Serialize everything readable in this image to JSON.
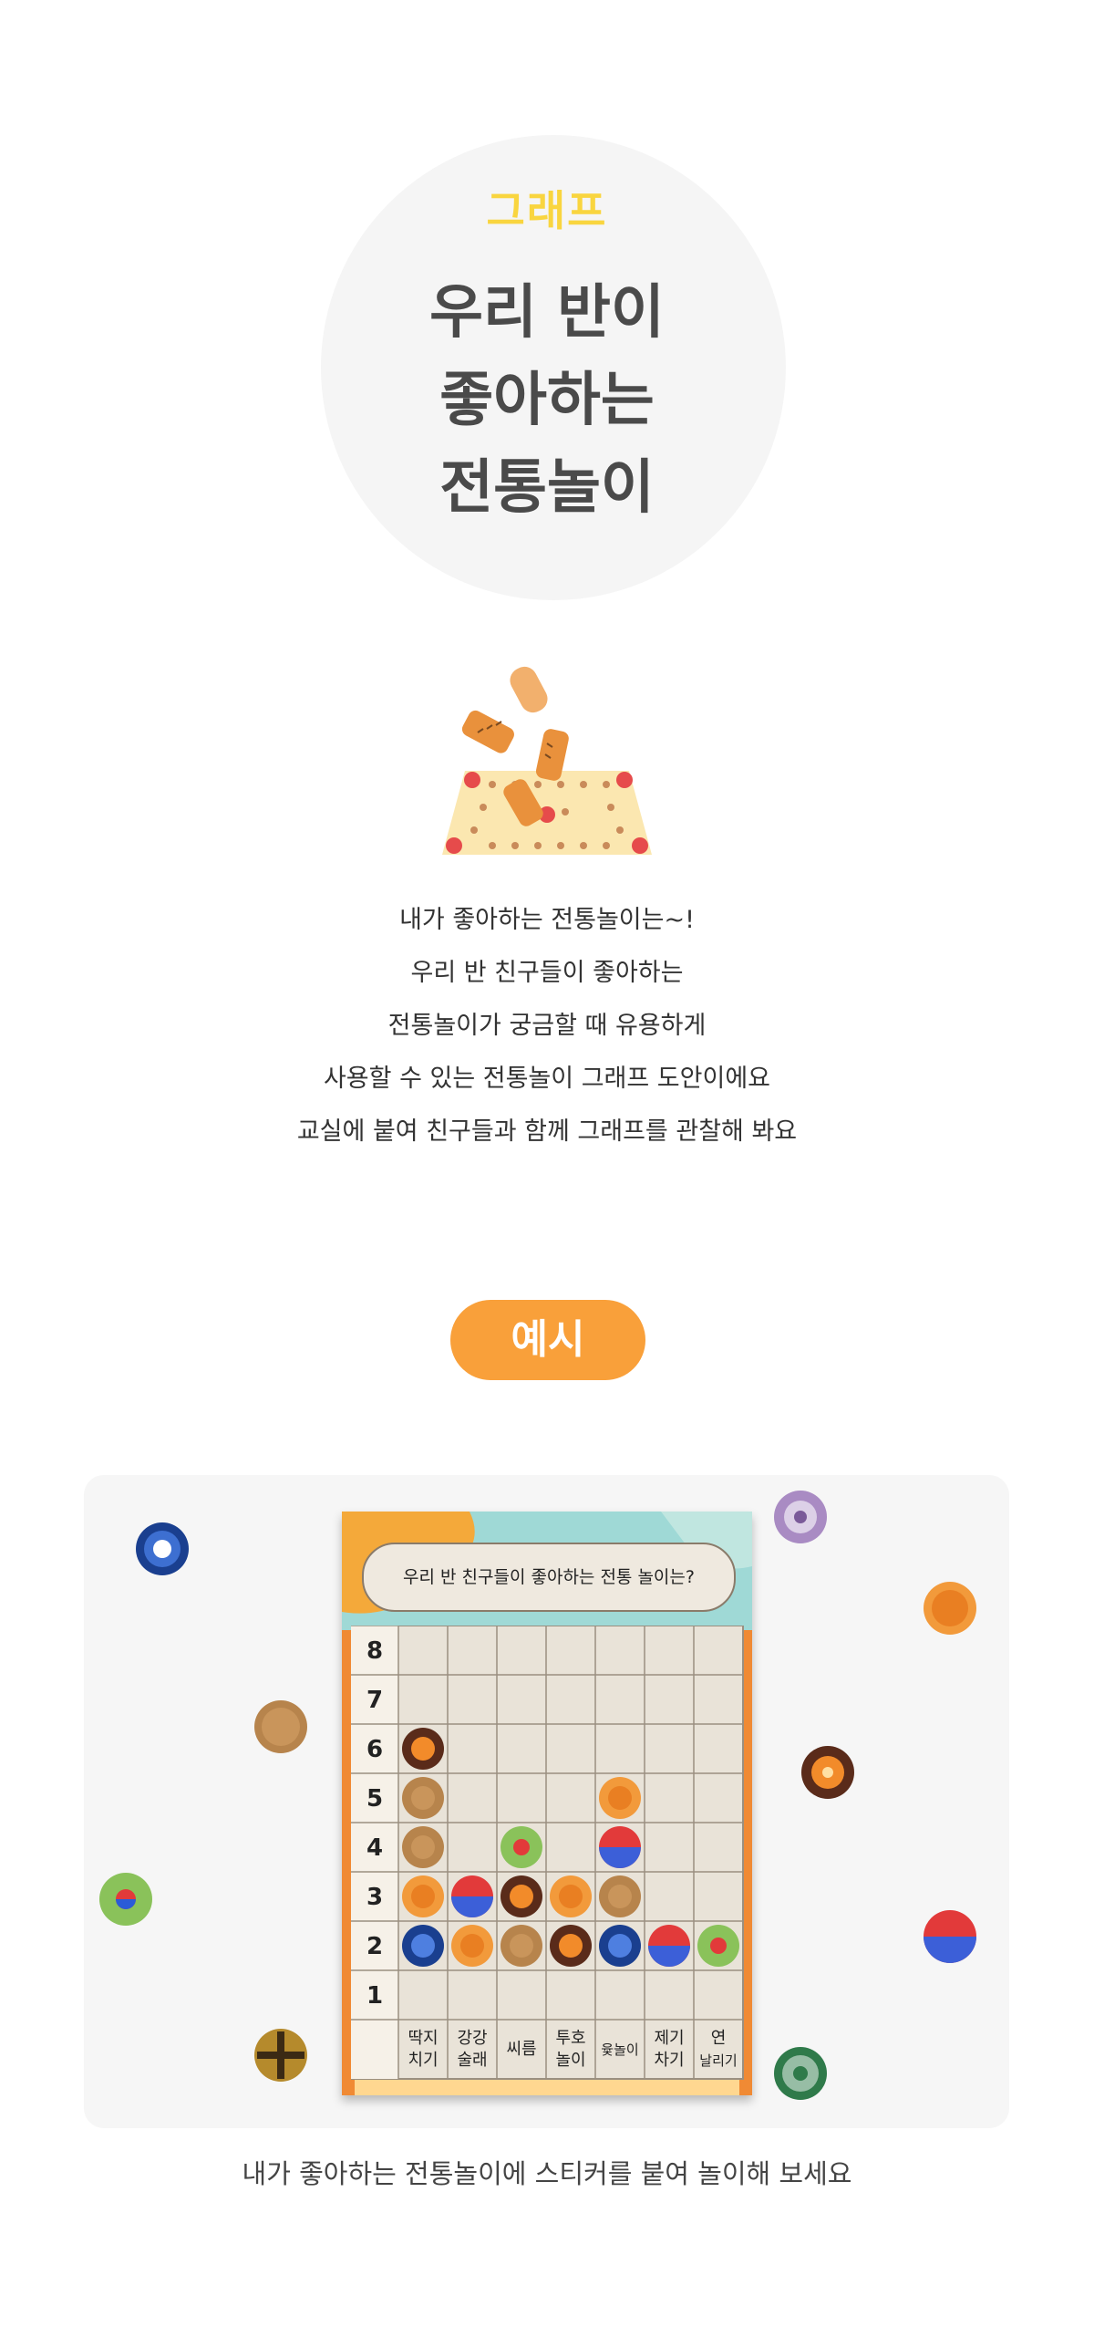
{
  "hero": {
    "tag": "그래프",
    "title_lines": [
      "우리 반이",
      "좋아하는",
      "전통놀이"
    ]
  },
  "description": {
    "lines": [
      "내가 좋아하는 전통놀이는~!",
      "우리 반 친구들이 좋아하는",
      "전통놀이가 궁금할 때 유용하게",
      "사용할 수 있는 전통놀이 그래프 도안이에요",
      "교실에 붙여 친구들과 함께 그래프를 관찰해 봐요"
    ]
  },
  "example": {
    "label": "예시"
  },
  "board": {
    "question": "우리 반 친구들이 좋아하는 전통 놀이는?",
    "rows": [
      "8",
      "7",
      "6",
      "5",
      "4",
      "3",
      "2",
      "1"
    ],
    "columns": [
      [
        "딱지",
        "치기"
      ],
      [
        "강강",
        "술래"
      ],
      [
        "씨름",
        ""
      ],
      [
        "투호",
        "놀이"
      ],
      [
        "윷놀이",
        ""
      ],
      [
        "제기",
        "차기"
      ],
      [
        "연",
        "날리기"
      ]
    ]
  },
  "caption": "내가 좋아하는 전통놀이에 스티커를 붙여 놀이해 보세요",
  "colors": {
    "accent_orange": "#f9a03a",
    "tag_yellow": "#f9d53f",
    "title_gray": "#4a4a4a",
    "circle_bg": "#f5f5f5"
  }
}
